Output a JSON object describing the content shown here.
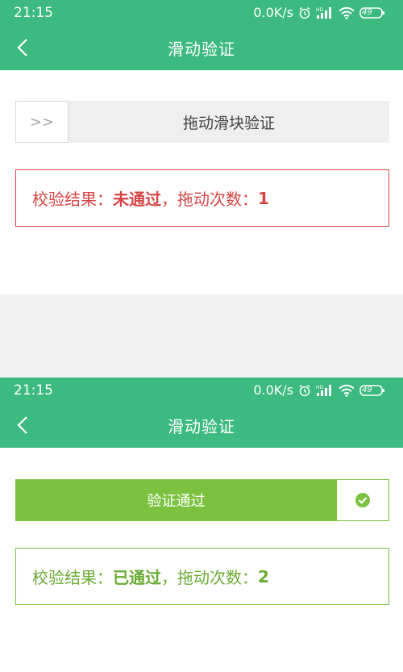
{
  "colors": {
    "primary_green": "#3cba7f",
    "success_green": "#7cc240",
    "fail_red": "#d64545",
    "track_gray": "#efefef"
  },
  "screens": [
    {
      "status_bar": {
        "time": "21:15",
        "net_speed": "0.0K/s",
        "battery": "49",
        "icons": [
          "alarm-icon",
          "signal-hd-icon",
          "wifi-icon",
          "battery-icon"
        ]
      },
      "app_bar": {
        "title": "滑动验证",
        "back_icon": "chevron-left-icon"
      },
      "slider": {
        "state": "unverified",
        "handle_symbol": ">>",
        "hint": "拖动滑块验证"
      },
      "result": {
        "prefix": "校验结果：",
        "status": "未通过",
        "sep": "，拖动次数：",
        "count": "1"
      }
    },
    {
      "status_bar": {
        "time": "21:15",
        "net_speed": "0.0K/s",
        "battery": "49",
        "icons": [
          "alarm-icon",
          "signal-hd-icon",
          "wifi-icon",
          "battery-icon"
        ]
      },
      "app_bar": {
        "title": "滑动验证",
        "back_icon": "chevron-left-icon"
      },
      "slider": {
        "state": "verified",
        "label": "验证通过",
        "handle_icon": "check-circle-icon"
      },
      "result": {
        "prefix": "校验结果：",
        "status": "已通过",
        "sep": "，拖动次数：",
        "count": "2"
      }
    }
  ]
}
